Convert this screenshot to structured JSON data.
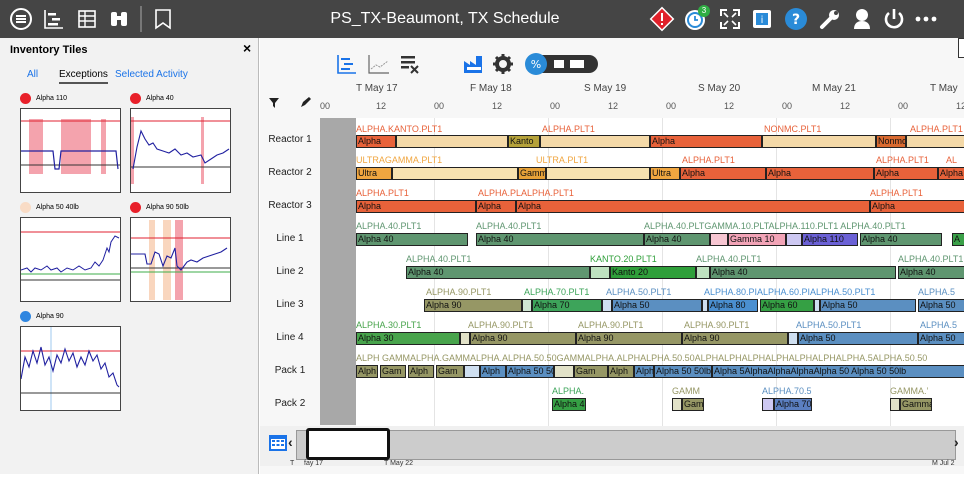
{
  "header": {
    "title": "PS_TX-Beaumont, TX Schedule",
    "badge_count": "3",
    "left_icons": [
      "schedule-icon",
      "gantt-icon",
      "table-icon",
      "binoculars-icon",
      "bookmark-icon"
    ],
    "right_icons": [
      "warning-diamond-icon",
      "clock-refresh-icon",
      "fullscreen-icon",
      "info-card-icon",
      "help-icon",
      "wrench-icon",
      "user-icon",
      "power-icon",
      "more-icon"
    ]
  },
  "left_panel": {
    "title": "Inventory Tiles",
    "close_label": "×",
    "tabs": [
      {
        "label": "All",
        "active": false
      },
      {
        "label": "Exceptions",
        "active": true
      },
      {
        "label": "Selected Activity",
        "active": false
      }
    ],
    "tiles": [
      {
        "label": "Alpha 110",
        "dot_color": "#e8202a"
      },
      {
        "label": "Alpha 40",
        "dot_color": "#e8202a"
      },
      {
        "label": "Alpha 50 40lb",
        "dot_color": "#f9dcc6"
      },
      {
        "label": "Alpha 90 50lb",
        "dot_color": "#e8202a"
      },
      {
        "label": "Alpha 90",
        "dot_color": "#2f86e0"
      }
    ]
  },
  "main": {
    "dates": [
      "T May 17",
      "F May 18",
      "S May 19",
      "S May 20",
      "M May 21",
      "T May"
    ],
    "hours": [
      "00",
      "12",
      "00",
      "12",
      "00",
      "12",
      "00",
      "12",
      "00",
      "12",
      "00",
      "12"
    ],
    "rows": [
      "Reactor 1",
      "Reactor 2",
      "Reactor 3",
      "Line 1",
      "Line 2",
      "Line 3",
      "Line 4",
      "Pack 1",
      "Pack 2"
    ],
    "nav_dates": [
      "T",
      "fay 17",
      "T May 22",
      "M Jul 2"
    ],
    "activity_labels": {
      "alpha_kanto_plt1": "ALPHA.KANTO.PLT1",
      "alpha_plt1": "ALPHA.PLT1",
      "nonmc_plt1": "NONMC.PLT1",
      "ultragamma_plt1": "ULTRAGAMMA.PLT1",
      "ultra_plt1": "ULTRA.PLT1",
      "alpha_plt1_short": "ALPHA.PLT1",
      "alpha_plt1_trunc": "ALPHA.PLT1",
      "alpha_plt1_dbl": "ALPHA.PLALPHA.PLT1",
      "alpha40_plt1": "ALPHA.40.PLT1",
      "alpha40_gamma10": "ALPHA.40.PLTGAMMA.10.PLTALPHA.110.PLT1 ALPHA.40.PLT1",
      "al": "AL",
      "kanto20_plt1": "KANTO.20.PLT1",
      "alpha90_plt1": "ALPHA.90.PLT1",
      "alpha70_plt1": "ALPHA.70.PLT1",
      "alpha50_plt1": "ALPHA.50.PLT1",
      "line3_multi": "ALPHA.80.PIALPHA.60.PIALPHA.50.PLT1",
      "alpha50_trunc": "ALPHA.5",
      "alpha30_plt1": "ALPHA.30.PLT1",
      "pack1_a": "ALPH GAMMALPHA.GAMMALPHA.ALPHA.50.50GAMMALPHA.ALPHALPHA.50.50ALPHALPHALPHALPHALPHALPHALPHA.5ALPHA.50.50",
      "alpha_dot": "ALPHA.",
      "gamm": "GAMM",
      "alpha70_5": "ALPHA.70.5",
      "gamma_dot": "GAMMA.’"
    },
    "bar_text": {
      "alpha": "Alpha",
      "kanto": "Kanto",
      "nonmc": "Nonmc",
      "ultra": "Ultra",
      "gamm": "Gamm",
      "alpha40": "Alpha 40",
      "gamma10": "Gamma 10",
      "alpha110": "Alpha 110",
      "a": "A",
      "kanto20": "Kanto 20",
      "alpha90": "Alpha 90",
      "alpha70": "Alpha 70",
      "alpha50": "Alpha 50",
      "alpha80": "Alpha 80",
      "alpha60": "Alpha 60",
      "alpha30": "Alpha 30",
      "alph": "Alph",
      "gam": "Gam",
      "alpha50_50lb": "Alpha 50 50lb",
      "alpha_a": "Alph",
      "pack1_tail": "Alpha 5AlphaAlphaAlphaAlpha 50 Alpha 50 50lb",
      "alpha4": "Alpha 4",
      "gamm2": "Gam",
      "alpha70b": "Alpha 70",
      "gamma": "Gamma"
    },
    "colors": {
      "alpha_orange": "#e8623a",
      "kanto_olive": "#b5a23a",
      "alpha40_green": "#5f9670",
      "gamma10_pink": "#f2a4b7",
      "alpha110_purple": "#6b61d6",
      "kanto20_green": "#2f9f3a",
      "alpha90_olive": "#969765",
      "alpha70_green": "#3da45a",
      "alpha50_blue": "#5b8fc1",
      "alpha80_blue": "#4a8fd0",
      "alpha60_green": "#35a044",
      "alpha30_green": "#48a44c",
      "ultra_orange": "#f0a640"
    }
  }
}
